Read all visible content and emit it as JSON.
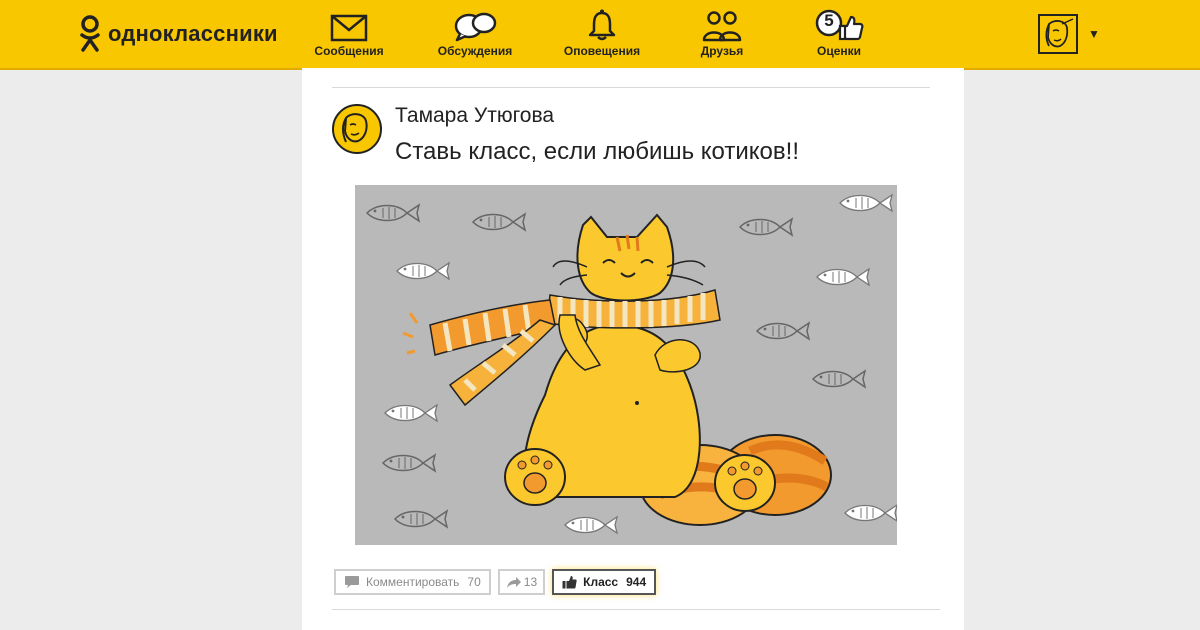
{
  "app": {
    "brand": "одноклассники",
    "accent_color": "#f9c700"
  },
  "nav": {
    "items": [
      {
        "label": "Сообщения",
        "icon": "envelope-icon"
      },
      {
        "label": "Обсуждения",
        "icon": "speech-bubbles-icon"
      },
      {
        "label": "Оповещения",
        "icon": "bell-icon"
      },
      {
        "label": "Друзья",
        "icon": "friends-icon"
      },
      {
        "label": "Оценки",
        "icon": "rating-thumbs-up-icon",
        "badge": "5"
      }
    ]
  },
  "profile": {
    "avatar_icon": "user-avatar-icon",
    "menu_icon": "dropdown-caret-icon"
  },
  "post": {
    "author": "Тамара Утюгова",
    "text": "Ставь класс, если любишь котиков!!",
    "image_icon": "cat-with-scarf-illustration"
  },
  "actions": {
    "comment": {
      "label": "Комментировать",
      "count": "70"
    },
    "share": {
      "count": "13"
    },
    "klass": {
      "label": "Класс",
      "count": "944"
    }
  }
}
